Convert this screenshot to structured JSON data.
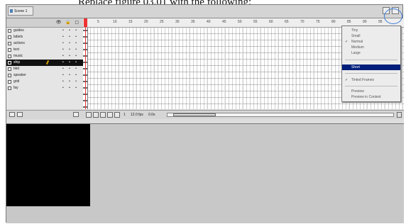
{
  "caption": {
    "text": "Replace figure 03.01 with the following:"
  },
  "scene": {
    "tab_label": "Scene 1"
  },
  "layers": [
    {
      "name": "guides"
    },
    {
      "name": "labels"
    },
    {
      "name": "actions"
    },
    {
      "name": "text"
    },
    {
      "name": "music"
    },
    {
      "name": "ship",
      "active": true
    },
    {
      "name": "bkd"
    },
    {
      "name": "speaker"
    },
    {
      "name": "grid"
    },
    {
      "name": "fay"
    }
  ],
  "ruler": {
    "numbers": [
      "5",
      "10",
      "15",
      "20",
      "25",
      "30",
      "35",
      "40",
      "45",
      "50",
      "55",
      "60",
      "65",
      "70",
      "75",
      "80",
      "85",
      "90",
      "95"
    ]
  },
  "status": {
    "frame": "1",
    "fps": "12.0 fps",
    "time": "0.0s"
  },
  "menu": {
    "items": [
      {
        "label": "Tiny"
      },
      {
        "label": "Small"
      },
      {
        "label": "Normal",
        "checked": true
      },
      {
        "label": "Medium"
      },
      {
        "label": "Large"
      },
      {
        "label": "Short",
        "highlighted": true
      },
      {
        "label": "Tinted Frames",
        "checked": true
      },
      {
        "label": "Preview"
      },
      {
        "label": "Preview in Context"
      }
    ]
  }
}
